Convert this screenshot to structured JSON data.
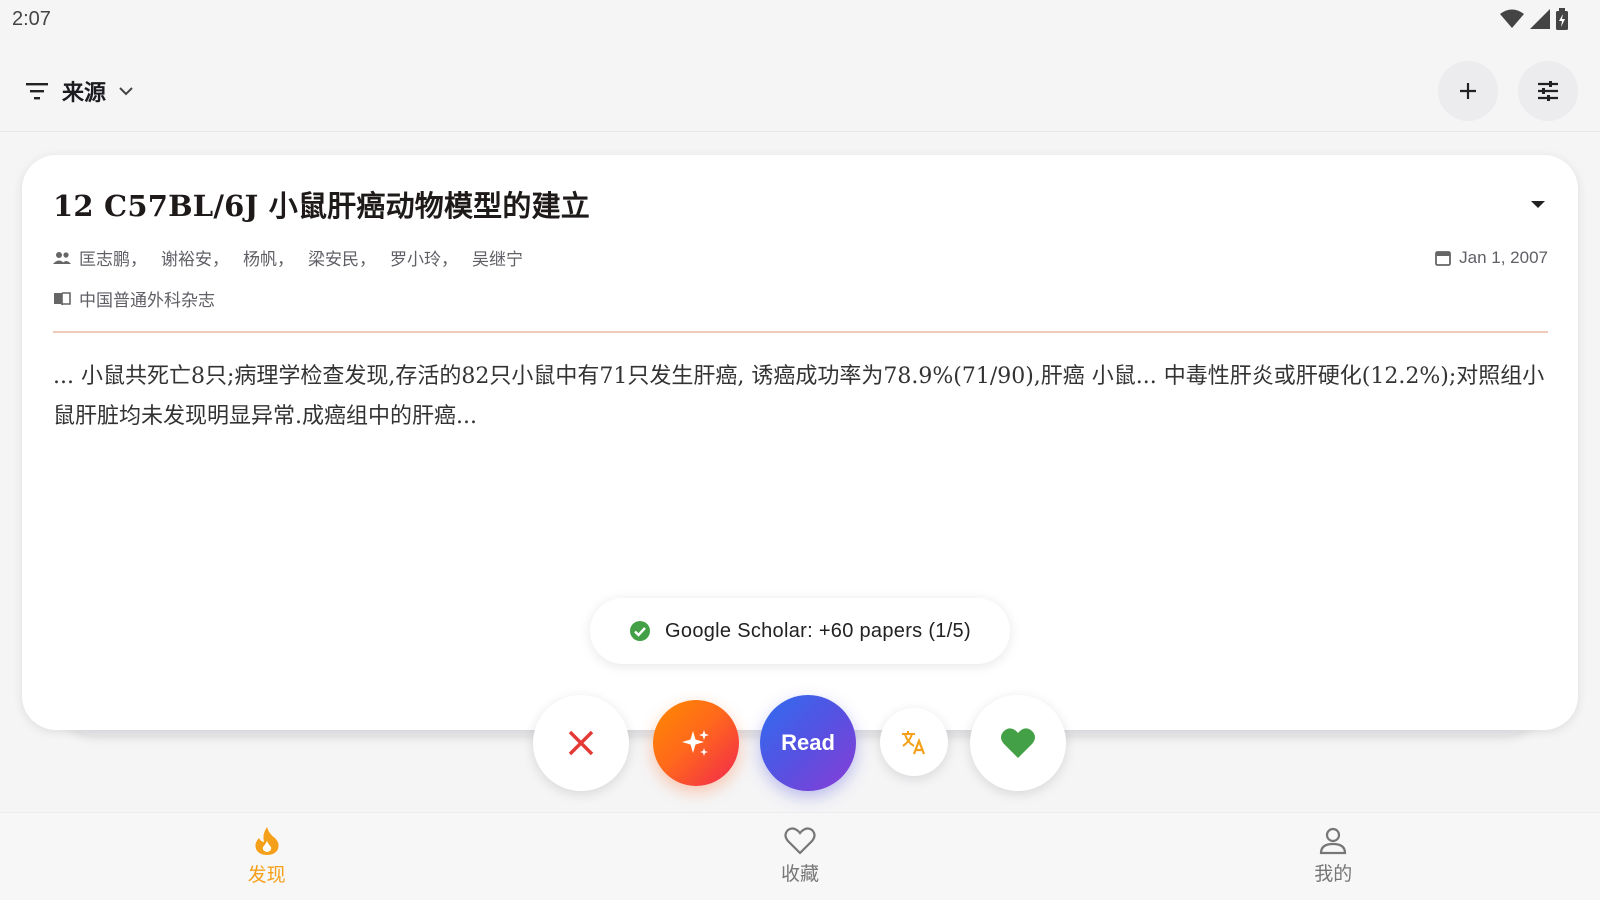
{
  "status_bar": {
    "time": "2:07"
  },
  "app_bar": {
    "source_label": "来源"
  },
  "paper": {
    "title": "12 C57BL/6J 小鼠肝癌动物模型的建立",
    "authors": [
      "匡志鹏，",
      "谢裕安，",
      "杨帆，",
      "梁安民，",
      "罗小玲，",
      "吴继宁"
    ],
    "date": "Jan 1, 2007",
    "journal": "中国普通外科杂志",
    "abstract": "... 小鼠共死亡8只;病理学检查发现,存活的82只小鼠中有71只发生肝癌, 诱癌成功率为78.9%(71/90),肝癌 小鼠... 中毒性肝炎或肝硬化(12.2%);对照组小鼠肝脏均未发现明显异常.成癌组中的肝癌..."
  },
  "toast": {
    "text": "Google Scholar: +60 papers (1/5)"
  },
  "actions": {
    "read_label": "Read"
  },
  "bottom_nav": {
    "items": [
      {
        "label": "发现",
        "icon": "flame-icon",
        "active": true
      },
      {
        "label": "收藏",
        "icon": "heart-outline-icon",
        "active": false
      },
      {
        "label": "我的",
        "icon": "person-icon",
        "active": false
      }
    ]
  },
  "colors": {
    "accent_active": "#f5a01a",
    "dismiss": "#e53935",
    "like": "#43a047",
    "divider": "#f0c9b8"
  }
}
